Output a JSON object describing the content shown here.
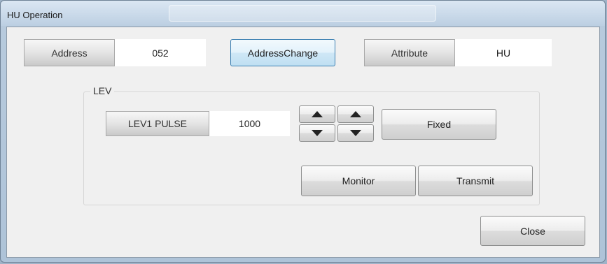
{
  "window": {
    "title": "HU Operation"
  },
  "header": {
    "address_label": "Address",
    "address_value": "052",
    "address_change_button": "AddressChange",
    "attribute_label": "Attribute",
    "attribute_value": "HU"
  },
  "lev_group": {
    "title": "LEV",
    "pulse_label": "LEV1 PULSE",
    "pulse_value": "1000",
    "fixed_button": "Fixed",
    "monitor_button": "Monitor",
    "transmit_button": "Transmit"
  },
  "footer": {
    "close_button": "Close"
  }
}
